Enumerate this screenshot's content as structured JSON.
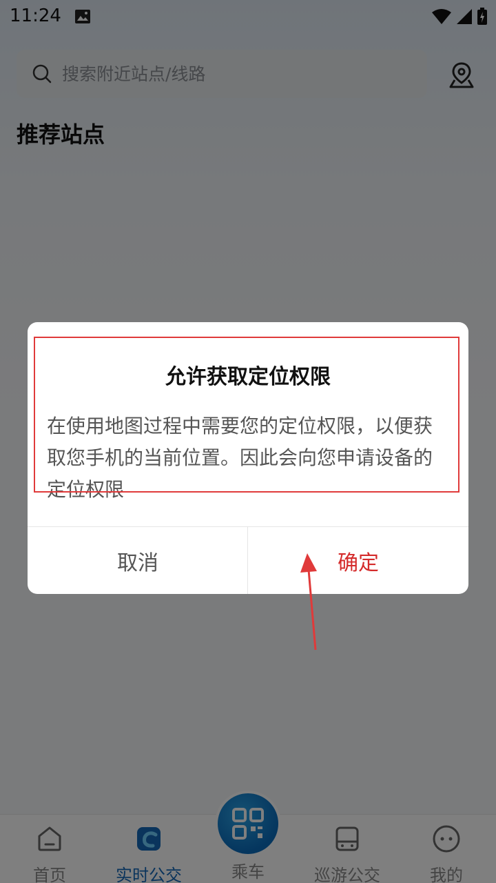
{
  "status_bar": {
    "time": "11:24"
  },
  "search": {
    "placeholder": "搜索附近站点/线路"
  },
  "section": {
    "title": "推荐站点"
  },
  "bottom_nav": {
    "items": [
      {
        "label": "首页",
        "icon": "home-icon"
      },
      {
        "label": "实时公交",
        "icon": "realtime-bus-icon",
        "active": true
      },
      {
        "label": "乘车",
        "icon": "qr-code-icon"
      },
      {
        "label": "巡游公交",
        "icon": "tour-bus-icon"
      },
      {
        "label": "我的",
        "icon": "profile-icon"
      }
    ]
  },
  "dialog": {
    "title": "允许获取定位权限",
    "body": "在使用地图过程中需要您的定位权限，以便获取您手机的当前位置。因此会向您申请设备的定位权限",
    "cancel_label": "取消",
    "confirm_label": "确定"
  },
  "colors": {
    "accent": "#1468b8",
    "confirm": "#d42b2b",
    "annotation": "#e03a3a"
  }
}
